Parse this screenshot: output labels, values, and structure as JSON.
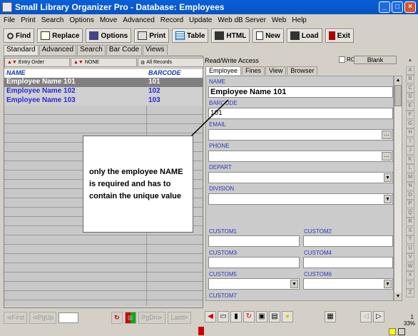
{
  "window": {
    "title": "Small Library Organizer Pro - Database:  Employees",
    "buttons": [
      "_",
      "□",
      "×"
    ]
  },
  "menu": [
    "File",
    "Print",
    "Search",
    "Options",
    "Move",
    "Advanced",
    "Record",
    "Update",
    "Web dB Server",
    "Web",
    "Help"
  ],
  "toolbar": [
    {
      "label": "Find",
      "icon": "magnifier-icon"
    },
    {
      "label": "Replace",
      "icon": "replace-icon"
    },
    {
      "label": "Options",
      "icon": "options-icon"
    },
    {
      "label": "Print",
      "icon": "printer-icon"
    },
    {
      "label": "Table",
      "icon": "table-icon"
    },
    {
      "label": "HTML",
      "icon": "html-icon"
    },
    {
      "label": "New",
      "icon": "new-document-icon"
    },
    {
      "label": "Load",
      "icon": "load-icon"
    },
    {
      "label": "Exit",
      "icon": "exit-icon"
    }
  ],
  "main_tabs": [
    "Standard",
    "Advanced",
    "Search",
    "Bar Code",
    "Views"
  ],
  "filters": [
    "Entry Order",
    "NONE",
    "All Records"
  ],
  "list": {
    "headers": {
      "name": "NAME",
      "barcode": "BARCODE"
    },
    "rows": [
      {
        "name": "Employee Name 101",
        "barcode": "101"
      },
      {
        "name": "Employee Name 102",
        "barcode": "102"
      },
      {
        "name": "Employee Name 103",
        "barcode": "103"
      }
    ]
  },
  "nav": {
    "first": "First",
    "pgup": "PgUp",
    "pgdn": "PgDn",
    "last": "Last"
  },
  "right": {
    "header": "Read/Write Access",
    "ro": "RO",
    "blank": "Blank",
    "tabs": [
      "Employee",
      "Fines",
      "View",
      "Browser"
    ]
  },
  "form": {
    "name": {
      "label": "NAME",
      "value": "Employee Name 101"
    },
    "barcode": {
      "label": "BARCODE",
      "value": "101"
    },
    "email": {
      "label": "EMAIL"
    },
    "phone": {
      "label": "PHONE"
    },
    "depart": {
      "label": "DEPART"
    },
    "division": {
      "label": "DIVISION"
    },
    "custom1": "CUSTOM1",
    "custom2": "CUSTOM2",
    "custom3": "CUSTOM3",
    "custom4": "CUSTOM4",
    "custom5": "CUSTOM5",
    "custom6": "CUSTOM6",
    "custom7": "CUSTOM7"
  },
  "alphabet": [
    "A",
    "B",
    "C",
    "D",
    "E",
    "F",
    "G",
    "H",
    "I",
    "J",
    "K",
    "L",
    "M",
    "N",
    "O",
    "P",
    "Q",
    "R",
    "S",
    "T",
    "U",
    "V",
    "W",
    "X",
    "Y",
    "Z"
  ],
  "status": {
    "percent": "33%",
    "count": "1"
  },
  "callout": "only the employee NAME is required and has to contain the unique value",
  "colors": {
    "title": "#0653c2",
    "label": "#2a3ab8",
    "selected_row": "#808080"
  }
}
